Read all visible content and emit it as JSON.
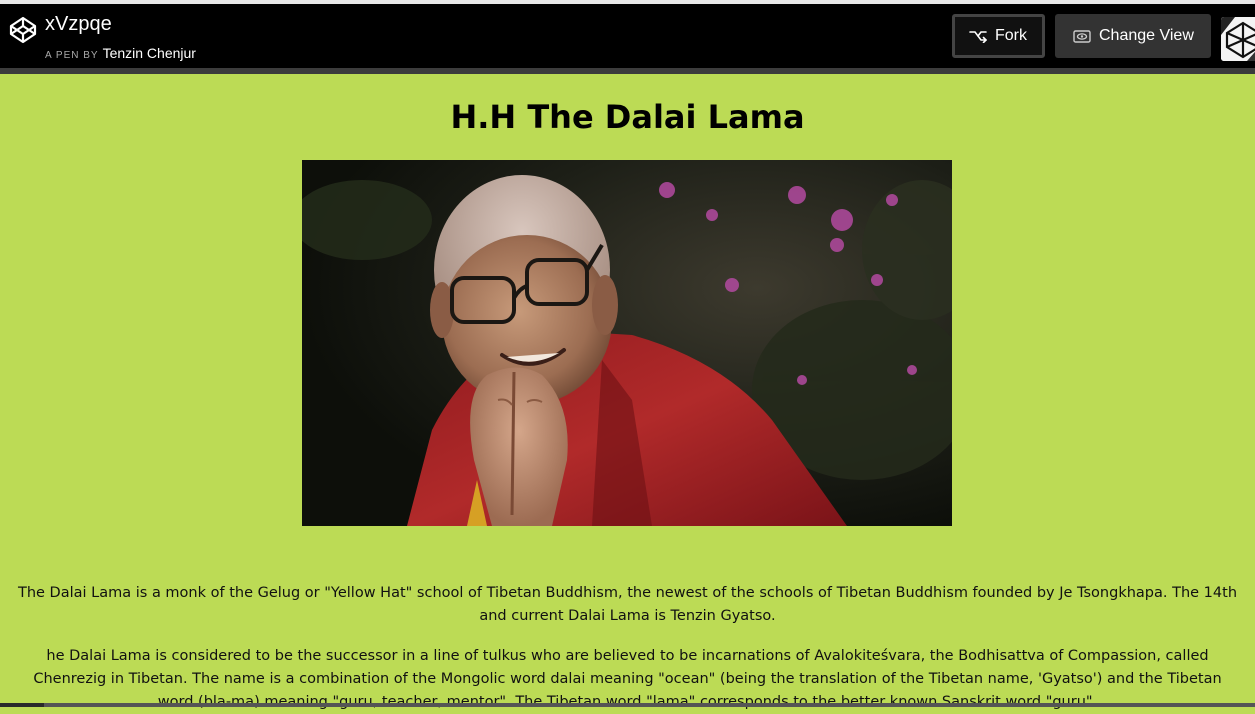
{
  "header": {
    "pen_title": "xVzpqe",
    "byline_prefix": "A PEN BY",
    "author": "Tenzin Chenjur",
    "fork_label": "Fork",
    "change_view_label": "Change View"
  },
  "main": {
    "title": "H.H The Dalai Lama",
    "paragraphs": [
      "The Dalai Lama is a monk of the Gelug or \"Yellow Hat\" school of Tibetan Buddhism, the newest of the schools of Tibetan Buddhism founded by Je Tsongkhapa. The 14th and current Dalai Lama is Tenzin Gyatso.",
      "he Dalai Lama is considered to be the successor in a line of tulkus who are believed to be incarnations of Avalokiteśvara, the Bodhisattva of Compassion, called Chenrezig in Tibetan. The name is a combination of the Mongolic word dalai meaning \"ocean\" (being the translation of the Tibetan name, 'Gyatso') and the Tibetan word (bla-ma) meaning \"guru, teacher, mentor\". The Tibetan word \"lama\" corresponds to the better known Sanskrit word \"guru\"."
    ]
  },
  "colors": {
    "page_background": "#bcdb55",
    "header_background": "#000000"
  },
  "icons": {
    "logo": "codepen-logo-icon",
    "fork": "fork-icon",
    "change_view": "eye-icon",
    "avatar": "user-avatar"
  }
}
